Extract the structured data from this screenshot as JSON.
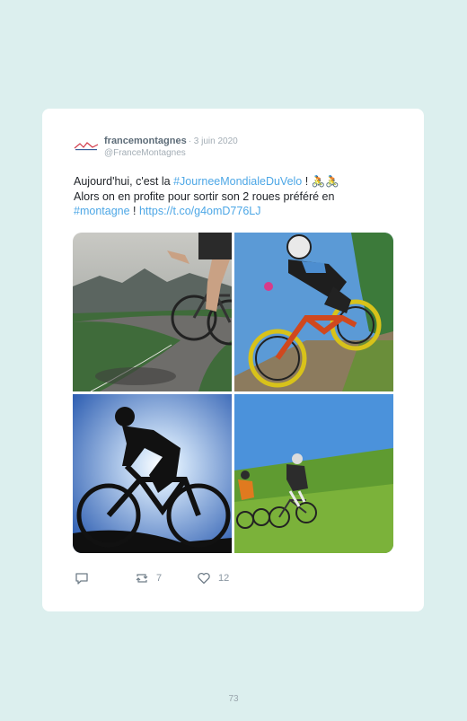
{
  "tweet": {
    "username": "francemontagnes",
    "date": "· 3 juin 2020",
    "handle": "@FranceMontagnes",
    "avatar_icon": "france-montagnes-logo",
    "text_line1_prefix": "Aujourd'hui, c'est la ",
    "hashtag1": "#JourneeMondialeDuVelo",
    "text_line1_suffix": " ! 🚴🚴",
    "text_line2": "Alors on en profite pour sortir son 2 roues préféré en",
    "hashtag2": "#montagne",
    "text_sep": " ! ",
    "link": "https://t.co/g4omD776LJ",
    "photos": [
      "road-cyclist-mountain-photo",
      "downhill-mountain-biker-photo",
      "silhouette-cyclist-photo",
      "cyclists-grassy-slope-photo"
    ],
    "reply_count": "",
    "retweet_count": "7",
    "like_count": "12"
  },
  "page_number": "73",
  "colors": {
    "background": "#dcefee",
    "card": "#ffffff",
    "link": "#4da7e6",
    "muted": "#a3adb5"
  }
}
